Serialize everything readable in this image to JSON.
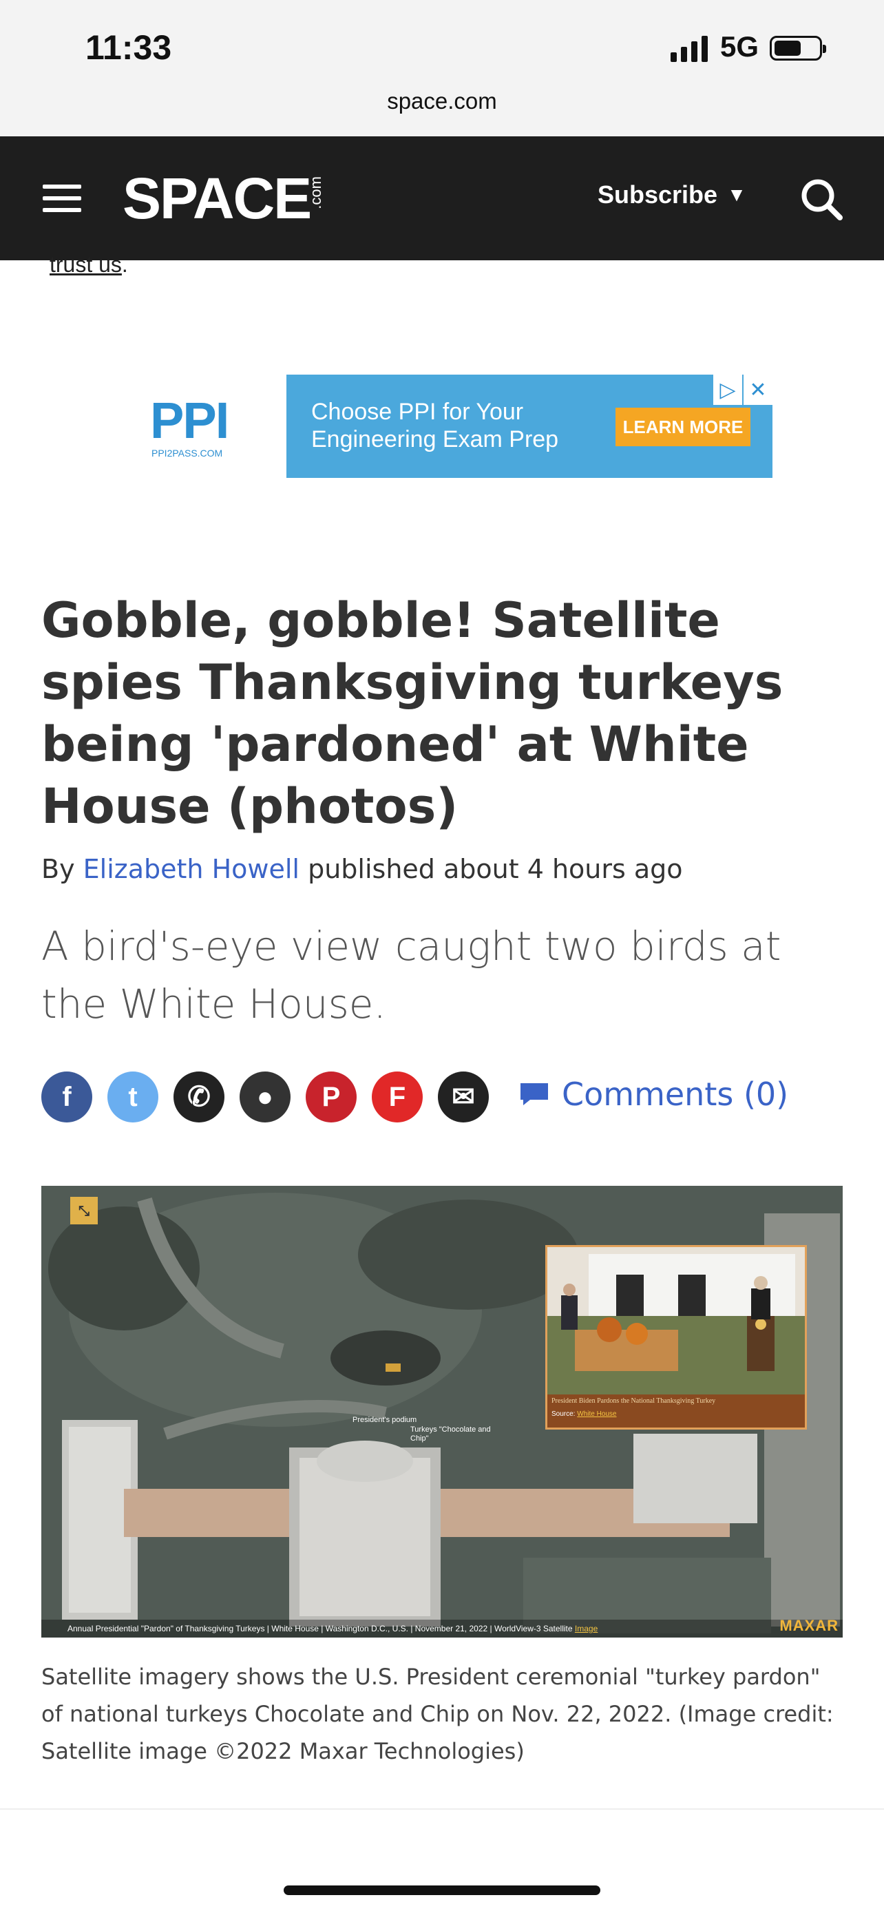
{
  "status_bar": {
    "time": "11:33",
    "network": "5G",
    "url": "space.com"
  },
  "nav": {
    "logo": "SPACE",
    "logo_suffix": ".com",
    "subscribe_label": "Subscribe",
    "subscribe_caret": "▼",
    "background": "#1e1e1e"
  },
  "top_fragment": {
    "link_text": "trust us",
    "trailing": "."
  },
  "ad": {
    "brand": "PPI",
    "brand_sub": "PPI2PASS.COM",
    "text": "Choose PPI for Your Engineering Exam Prep",
    "button": "LEARN MORE",
    "adchoices_icon": "▷",
    "close_icon": "✕",
    "colors": {
      "banner": "#4ba8dc",
      "button": "#f5a623"
    }
  },
  "article": {
    "headline": "Gobble, gobble! Satellite spies Thanksgiving turkeys being 'pardoned' at White House (photos)",
    "byline_prefix": "By",
    "author": "Elizabeth Howell",
    "published": "published about 4 hours ago",
    "strap": "A bird's-eye view caught two birds at the White House.",
    "comments_label": "Comments (0)",
    "link_color": "#3a63c7"
  },
  "share": [
    {
      "name": "facebook-icon",
      "glyph": "f",
      "color": "#3b5998"
    },
    {
      "name": "twitter-icon",
      "glyph": "t",
      "color": "#6aaef0"
    },
    {
      "name": "whatsapp-icon",
      "glyph": "✆",
      "color": "#222222"
    },
    {
      "name": "reddit-icon",
      "glyph": "●",
      "color": "#333333"
    },
    {
      "name": "pinterest-icon",
      "glyph": "P",
      "color": "#c8232c"
    },
    {
      "name": "flipboard-icon",
      "glyph": "F",
      "color": "#e12828"
    },
    {
      "name": "email-icon",
      "glyph": "✉",
      "color": "#222222"
    }
  ],
  "image": {
    "inset_caption": "President Biden Pardons the National Thanksgiving Turkey",
    "inset_source_prefix": "Source:",
    "inset_source_link": "White House",
    "label_podium": "President's podium",
    "label_turkeys": "Turkeys \"Chocolate and Chip\"",
    "footer": "Annual Presidential \"Pardon\" of Thanksgiving Turkeys | White House | Washington D.C., U.S. | November 21, 2022 | WorldView-3 Satellite",
    "footer_link": "Image",
    "watermark": "MAXAR"
  },
  "caption": "Satellite imagery shows the U.S. President ceremonial \"turkey pardon\" of national turkeys Chocolate and Chip on Nov. 22, 2022. (Image credit: Satellite image ©2022 Maxar Technologies)"
}
